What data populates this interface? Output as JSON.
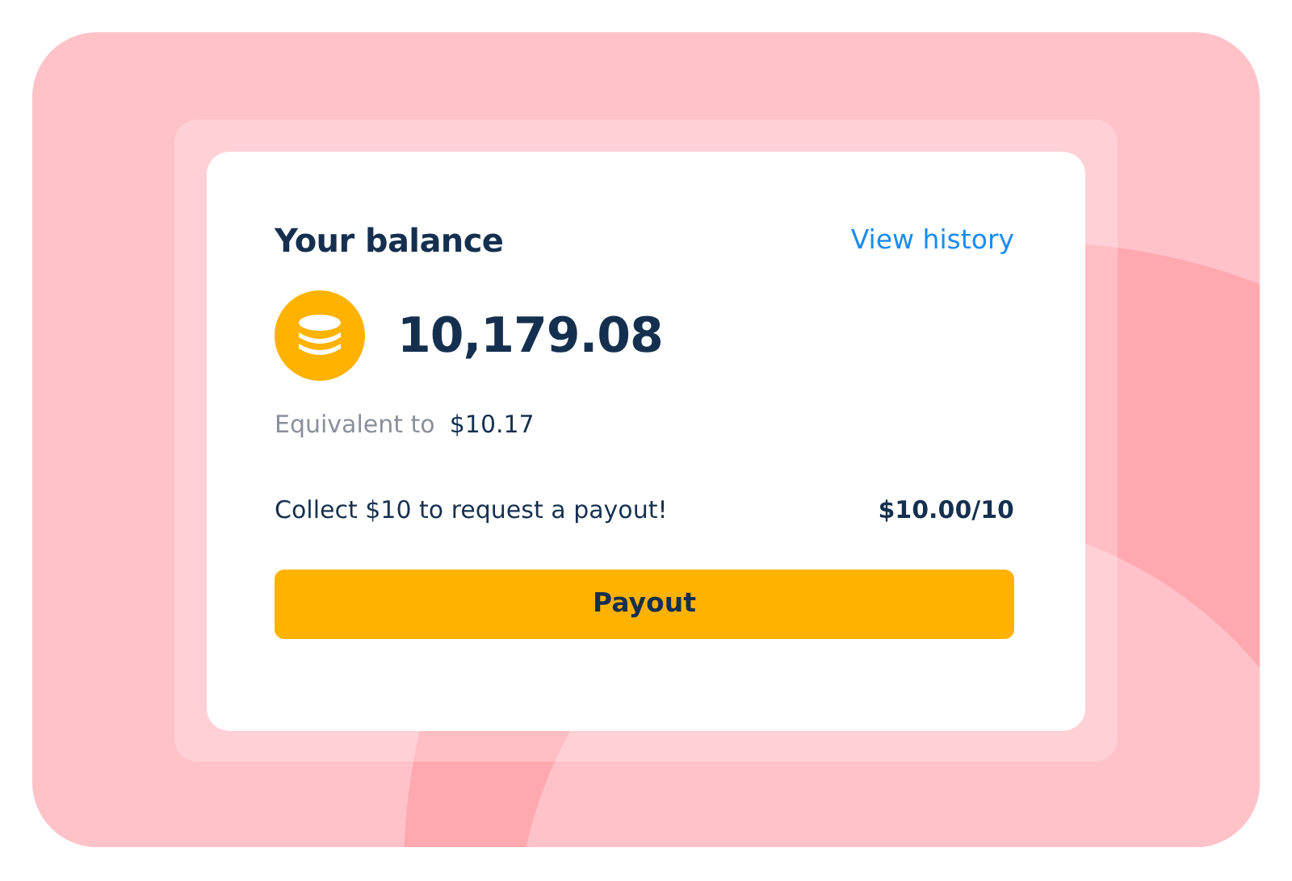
{
  "balance_card": {
    "title": "Your balance",
    "history_link": "View history",
    "amount": "10,179.08",
    "equivalent_label": "Equivalent to",
    "equivalent_value": "$10.17",
    "payout_message": "Collect $10 to request a payout!",
    "payout_progress": "$10.00/10",
    "payout_button": "Payout"
  }
}
